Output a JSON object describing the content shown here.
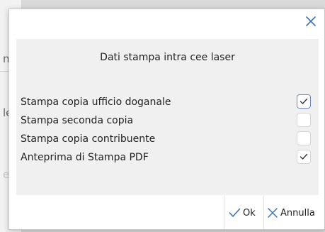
{
  "background_window": {
    "letters": [
      "n",
      "le",
      "er"
    ]
  },
  "dialog": {
    "title": "Dati stampa intra cee laser",
    "close_icon": "close-icon",
    "options": [
      {
        "label": "Stampa copia ufficio doganale",
        "checked": true,
        "focused": true
      },
      {
        "label": "Stampa seconda copia",
        "checked": false,
        "focused": false
      },
      {
        "label": "Stampa copia contribuente",
        "checked": false,
        "focused": false
      },
      {
        "label": "Anteprima di Stampa PDF",
        "checked": true,
        "focused": false
      }
    ],
    "buttons": {
      "ok_label": "Ok",
      "ok_icon": "check-icon",
      "cancel_label": "Annulla",
      "cancel_icon": "x-icon"
    }
  },
  "colors": {
    "accent": "#3f6fb5",
    "panel_bg": "#f0f0f0",
    "dialog_bg": "#ffffff"
  }
}
